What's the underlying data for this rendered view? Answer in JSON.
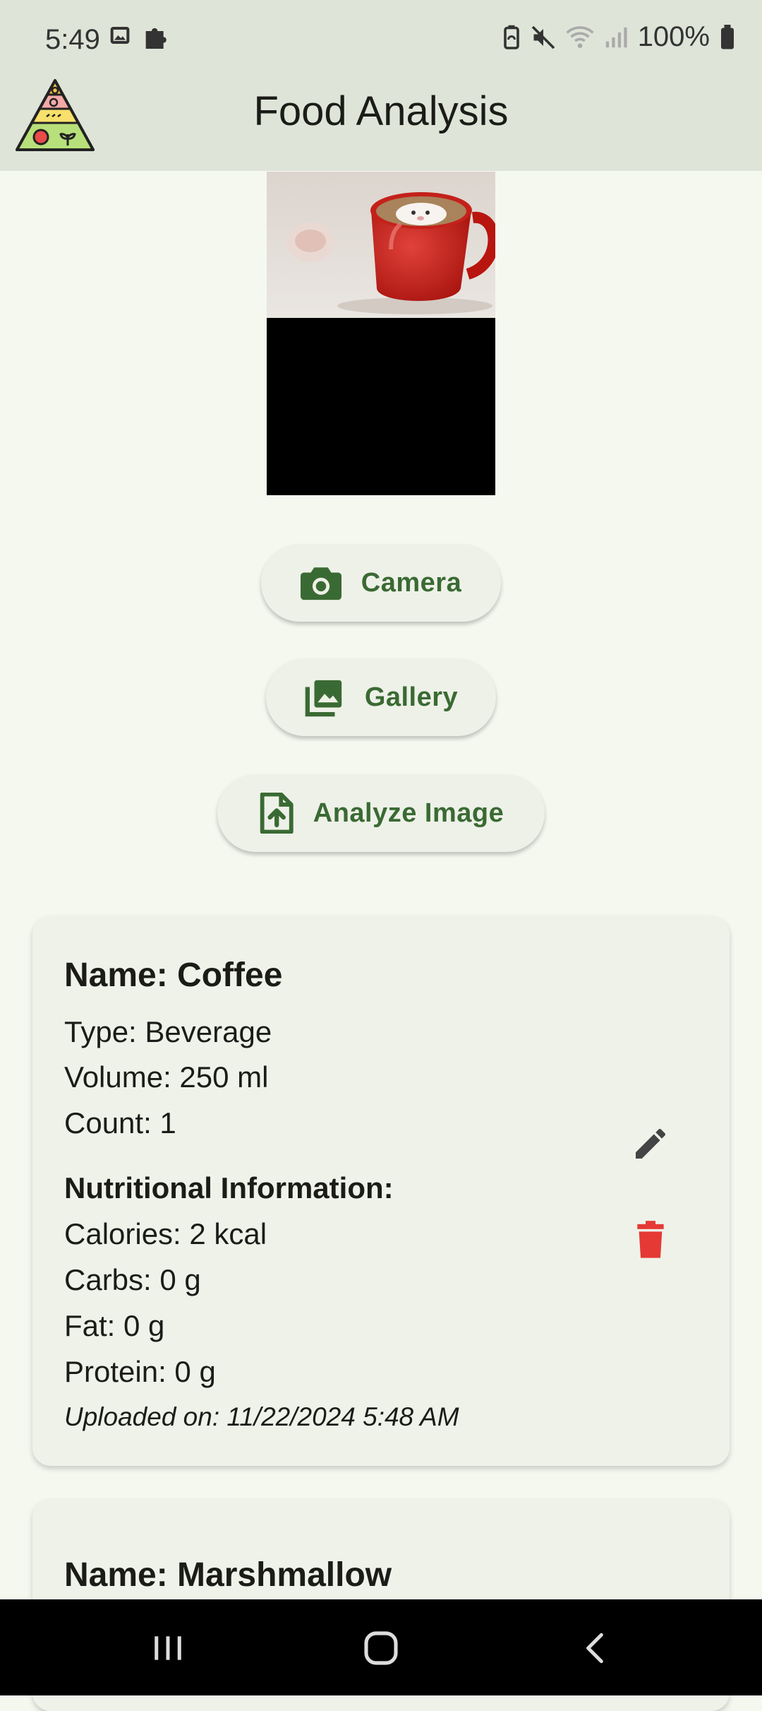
{
  "status_bar": {
    "time": "5:49",
    "battery_percent": "100%",
    "icons": [
      "image-icon",
      "puzzle-icon",
      "battery-saver-icon",
      "mute-icon",
      "wifi-icon",
      "signal-icon",
      "battery-icon"
    ]
  },
  "app_bar": {
    "title": "Food Analysis",
    "logo_icon": "food-pyramid-icon"
  },
  "actions": {
    "camera_label": "Camera",
    "gallery_label": "Gallery",
    "analyze_label": "Analyze Image"
  },
  "results": [
    {
      "name": "Name: Coffee",
      "type": "Type: Beverage",
      "volume": "Volume: 250 ml",
      "count": "Count: 1",
      "nutrition_heading": "Nutritional Information:",
      "calories": "Calories: 2 kcal",
      "carbs": "Carbs: 0 g",
      "fat": "Fat: 0 g",
      "protein": "Protein: 0 g",
      "uploaded": "Uploaded on: 11/22/2024 5:48 AM"
    },
    {
      "name": "Name: Marshmallow"
    }
  ],
  "colors": {
    "accent": "#3a6a33",
    "delete": "#e53935",
    "background": "#f5f8ef",
    "app_bar": "#dfe4d8"
  },
  "nav_bar": {
    "icons": [
      "recent-apps-icon",
      "home-icon",
      "back-icon"
    ]
  }
}
